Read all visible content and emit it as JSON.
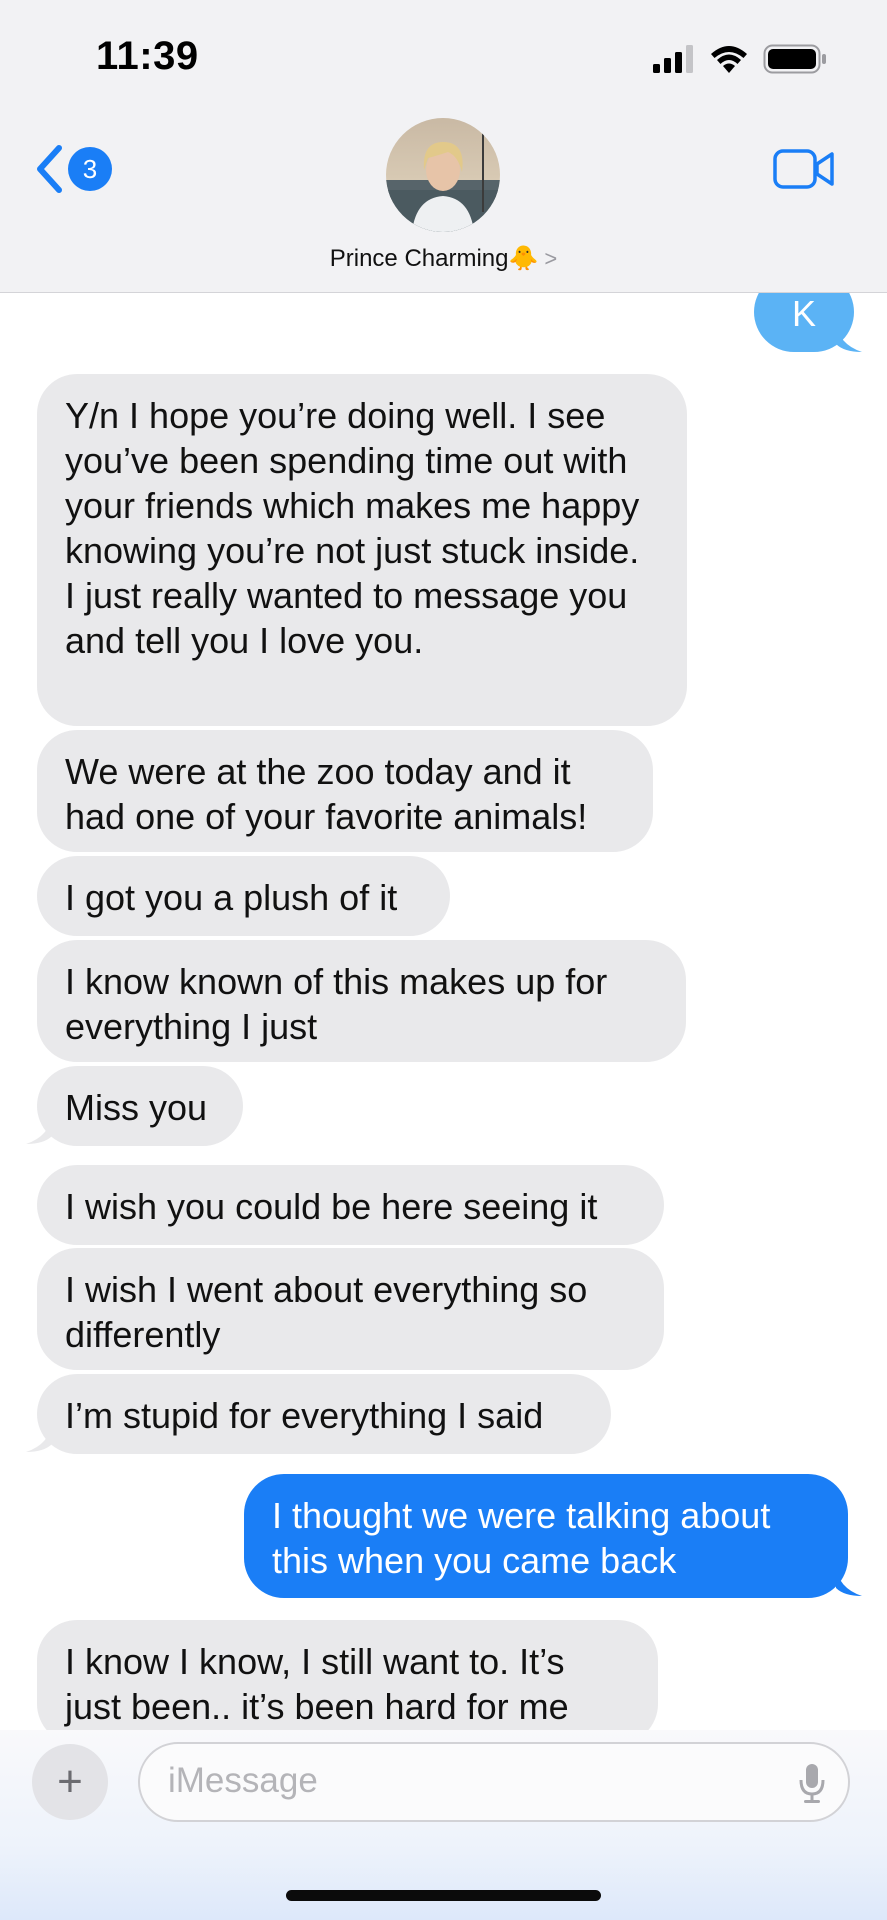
{
  "status_bar": {
    "time": "11:39"
  },
  "header": {
    "back_badge_count": "3",
    "contact_name": "Prince Charming🐥",
    "contact_chevron": ">",
    "avatar_icon": "contact-photo",
    "video_icon": "video-camera"
  },
  "messages": [
    {
      "from": "me",
      "text": "K"
    },
    {
      "from": "them",
      "text": "Y/n I hope you’re doing well. I see you’ve been spending time out with your friends which makes me happy knowing you’re not just stuck inside. I just really wanted to message you and tell you I love you."
    },
    {
      "from": "them",
      "text": "We were at the zoo today and it had one of your favorite animals!"
    },
    {
      "from": "them",
      "text": "I got you a plush of it"
    },
    {
      "from": "them",
      "text": "I know known of this makes up for everything I just"
    },
    {
      "from": "them",
      "text": "Miss you"
    },
    {
      "from": "them",
      "text": "I wish you could be here seeing it"
    },
    {
      "from": "them",
      "text": "I wish I went about everything so differently"
    },
    {
      "from": "them",
      "text": "I’m stupid for everything I said"
    },
    {
      "from": "me",
      "text": "I thought we were talking about this when you came back"
    },
    {
      "from": "them",
      "text": "I know I know, I still want to. It’s just been.. it’s been hard for me"
    }
  ],
  "composer": {
    "plus_label": "+",
    "placeholder": "iMessage"
  },
  "colors": {
    "outgoing_bubble": "#1a7ef6",
    "outgoing_bubble_faded": "#5bb3f5",
    "incoming_bubble": "#e9e9eb",
    "header_background": "#f2f2f4"
  }
}
